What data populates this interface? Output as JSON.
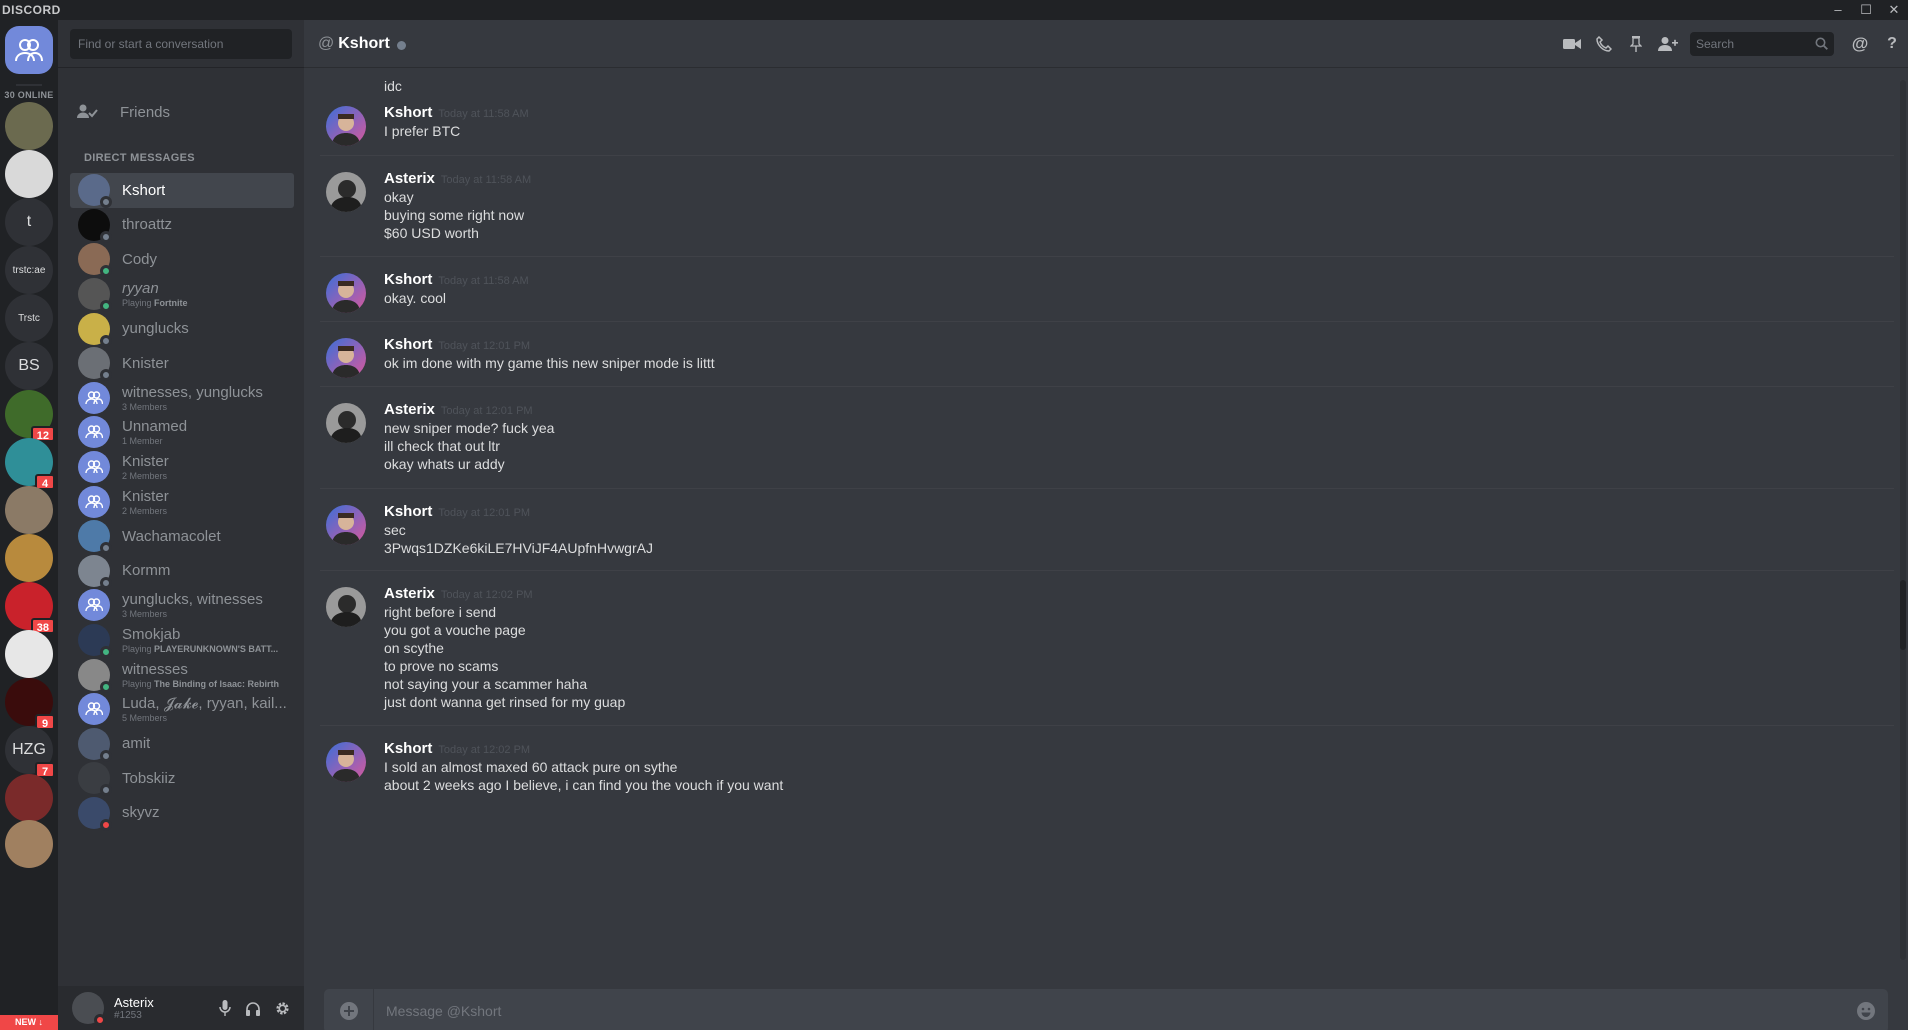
{
  "titlebar": {
    "brand": "DISCORD",
    "minimize": "–",
    "maximize": "☐",
    "close": "✕"
  },
  "guilds": {
    "online_count": "30 ONLINE",
    "items": [
      {
        "label": "",
        "kind": "home",
        "badge": ""
      },
      {
        "label": "",
        "kind": "image",
        "color": "#6b6a4f",
        "badge": ""
      },
      {
        "label": "",
        "kind": "image",
        "color": "#d9d9d9",
        "badge": ""
      },
      {
        "label": "t",
        "kind": "text",
        "badge": ""
      },
      {
        "label": "trstc:ae",
        "kind": "text",
        "badge": ""
      },
      {
        "label": "Trstc",
        "kind": "text",
        "badge": ""
      },
      {
        "label": "BS",
        "kind": "text",
        "badge": ""
      },
      {
        "label": "",
        "kind": "image",
        "color": "#3f6b2a",
        "badge": "12"
      },
      {
        "label": "",
        "kind": "image",
        "color": "#2f8f98",
        "badge": "4"
      },
      {
        "label": "",
        "kind": "image",
        "color": "#8b7a66",
        "badge": ""
      },
      {
        "label": "",
        "kind": "image",
        "color": "#b88a3d",
        "badge": ""
      },
      {
        "label": "",
        "kind": "image",
        "color": "#c9222b",
        "badge": "38"
      },
      {
        "label": "",
        "kind": "image",
        "color": "#e7e7e7",
        "badge": ""
      },
      {
        "label": "",
        "kind": "image",
        "color": "#3a0c0c",
        "badge": "9"
      },
      {
        "label": "HZG",
        "kind": "text",
        "badge": "7"
      },
      {
        "label": "",
        "kind": "image",
        "color": "#7a2a2a",
        "badge": ""
      },
      {
        "label": "",
        "kind": "image",
        "color": "#a08060",
        "badge": ""
      }
    ],
    "new_label": "NEW ↓"
  },
  "dm": {
    "search_placeholder": "Find or start a conversation",
    "friends_label": "Friends",
    "header": "DIRECT MESSAGES",
    "items": [
      {
        "name": "Kshort",
        "sub": "",
        "sub_bold": "",
        "status": "offline",
        "color": "#5a6a8a",
        "active": true,
        "group": false
      },
      {
        "name": "throattz",
        "sub": "",
        "sub_bold": "",
        "status": "offline",
        "color": "#0d0d0d",
        "active": false,
        "group": false
      },
      {
        "name": "Cody",
        "sub": "",
        "sub_bold": "",
        "status": "online",
        "color": "#8a6a55",
        "active": false,
        "group": false
      },
      {
        "name": "ryyan",
        "sub": "Playing ",
        "sub_bold": "Fortnite",
        "status": "online",
        "color": "#555",
        "active": false,
        "group": false
      },
      {
        "name": "yunglucks",
        "sub": "",
        "sub_bold": "",
        "status": "offline",
        "color": "#c9b048",
        "active": false,
        "group": false
      },
      {
        "name": "Knister",
        "sub": "",
        "sub_bold": "",
        "status": "offline",
        "color": "#6b6f75",
        "active": false,
        "group": false
      },
      {
        "name": "witnesses, yunglucks",
        "sub": "3 Members",
        "sub_bold": "",
        "status": "",
        "color": "#7289da",
        "active": false,
        "group": true
      },
      {
        "name": "Unnamed",
        "sub": "1 Member",
        "sub_bold": "",
        "status": "",
        "color": "#7289da",
        "active": false,
        "group": true
      },
      {
        "name": "Knister",
        "sub": "2 Members",
        "sub_bold": "",
        "status": "",
        "color": "#7289da",
        "active": false,
        "group": true
      },
      {
        "name": "Knister",
        "sub": "2 Members",
        "sub_bold": "",
        "status": "",
        "color": "#7289da",
        "active": false,
        "group": true
      },
      {
        "name": "Wachamacolet",
        "sub": "",
        "sub_bold": "",
        "status": "offline",
        "color": "#4e7aa8",
        "active": false,
        "group": false
      },
      {
        "name": "Kormm",
        "sub": "",
        "sub_bold": "",
        "status": "offline",
        "color": "#7d8590",
        "active": false,
        "group": false
      },
      {
        "name": "yunglucks, witnesses",
        "sub": "3 Members",
        "sub_bold": "",
        "status": "",
        "color": "#7289da",
        "active": false,
        "group": true
      },
      {
        "name": "Smokjab",
        "sub": "Playing ",
        "sub_bold": "PLAYERUNKNOWN'S BATT...",
        "status": "online",
        "color": "#2c3a55",
        "active": false,
        "group": false
      },
      {
        "name": "witnesses",
        "sub": "Playing ",
        "sub_bold": "The Binding of Isaac: Rebirth",
        "status": "online",
        "color": "#888",
        "active": false,
        "group": false
      },
      {
        "name": "Luda, 𝓙𝓪𝓴𝓮, ryyan, kail...",
        "sub": "5 Members",
        "sub_bold": "",
        "status": "",
        "color": "#7289da",
        "active": false,
        "group": true
      },
      {
        "name": "amit",
        "sub": "",
        "sub_bold": "",
        "status": "offline",
        "color": "#4e5a70",
        "active": false,
        "group": false
      },
      {
        "name": "Tobskiiz",
        "sub": "",
        "sub_bold": "",
        "status": "offline",
        "color": "#3a3d42",
        "active": false,
        "group": false
      },
      {
        "name": "skyvz",
        "sub": "",
        "sub_bold": "",
        "status": "dnd",
        "color": "#3a4a6a",
        "active": false,
        "group": false
      }
    ]
  },
  "user": {
    "name": "Asterix",
    "tag": "#1253"
  },
  "chat": {
    "name": "Kshort",
    "search_placeholder": "Search",
    "composer_placeholder": "Message @Kshort",
    "cutoff_text": "idc",
    "messages": [
      {
        "author": "Kshort",
        "time": "Today at 11:58 AM",
        "lines": [
          "I prefer BTC"
        ],
        "avatar": "kshort"
      },
      {
        "author": "Asterix",
        "time": "Today at 11:58 AM",
        "lines": [
          "okay",
          "buying some right now",
          "$60 USD worth"
        ],
        "avatar": "asterix"
      },
      {
        "author": "Kshort",
        "time": "Today at 11:58 AM",
        "lines": [
          "okay. cool"
        ],
        "avatar": "kshort"
      },
      {
        "author": "Kshort",
        "time": "Today at 12:01 PM",
        "lines": [
          "ok im done with my game this new sniper mode is littt"
        ],
        "avatar": "kshort"
      },
      {
        "author": "Asterix",
        "time": "Today at 12:01 PM",
        "lines": [
          "new sniper mode? fuck yea",
          "ill check that out ltr",
          "okay whats ur addy"
        ],
        "avatar": "asterix"
      },
      {
        "author": "Kshort",
        "time": "Today at 12:01 PM",
        "lines": [
          "sec",
          "3Pwqs1DZKe6kiLE7HViJF4AUpfnHvwgrAJ"
        ],
        "avatar": "kshort"
      },
      {
        "author": "Asterix",
        "time": "Today at 12:02 PM",
        "lines": [
          "right before i send",
          "you got a vouche page",
          "on scythe",
          "to prove no scams",
          "not saying your a scammer haha",
          "just dont wanna get rinsed for my guap"
        ],
        "avatar": "asterix"
      },
      {
        "author": "Kshort",
        "time": "Today at 12:02 PM",
        "lines": [
          "I sold an almost maxed 60 attack pure on sythe",
          "about 2 weeks ago I believe, i can find you the vouch if you want"
        ],
        "avatar": "kshort"
      }
    ]
  },
  "colors": {
    "blurple": "#7289da",
    "online": "#43b581",
    "offline": "#747f8d",
    "dnd": "#f04747",
    "badge": "#f04747"
  }
}
